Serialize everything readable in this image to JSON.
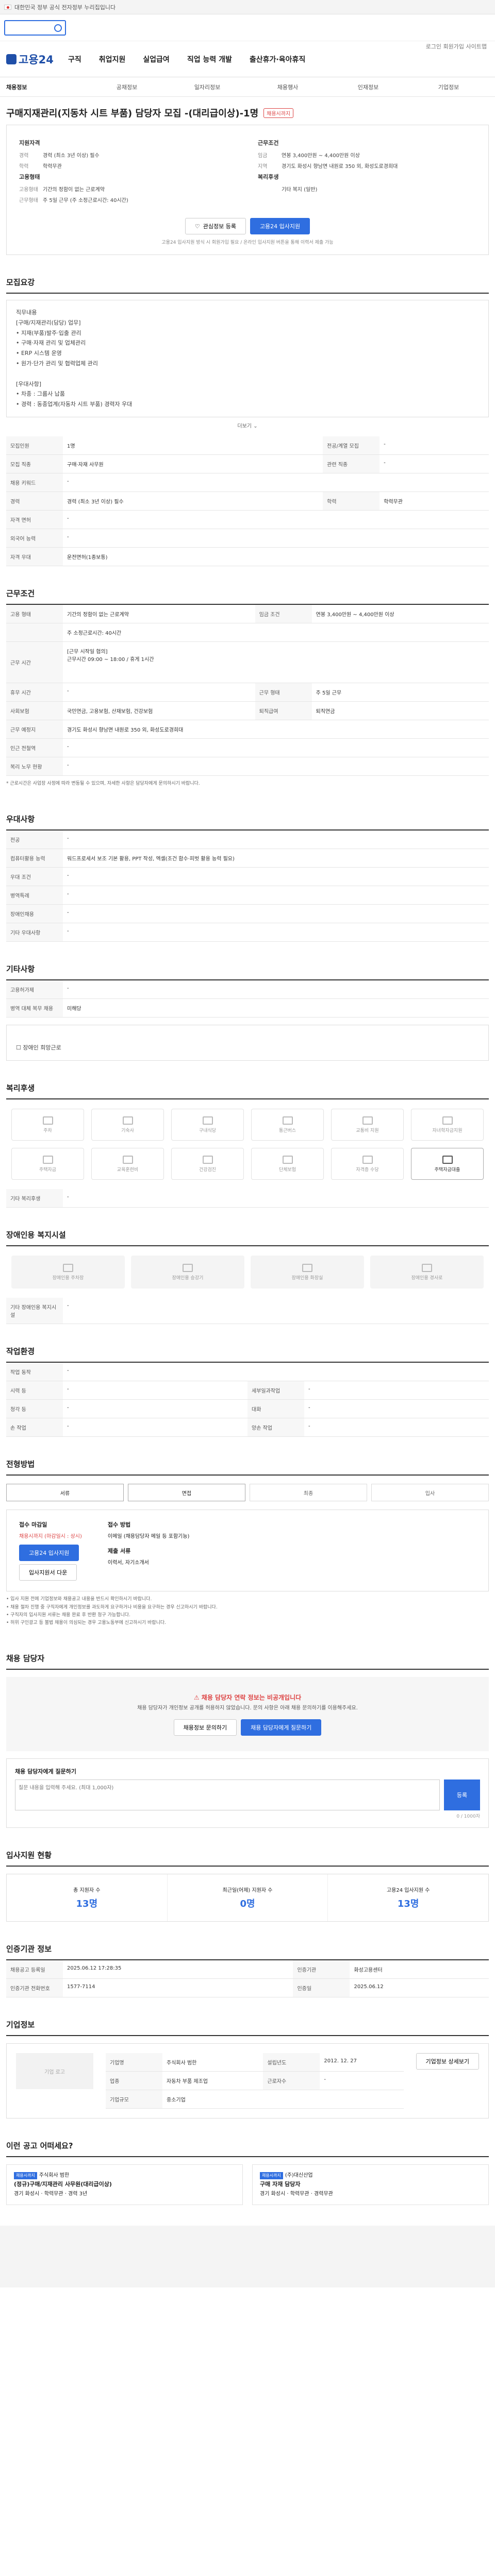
{
  "topbar": {
    "text": "대한민국 정부 공식 전자정부 누리집입니다"
  },
  "header": {
    "logo": "고용24",
    "util_links": "로그인  회원가입  사이트맵",
    "nav": [
      "구직",
      "취업지원",
      "실업급여",
      "직업 능력 개발",
      "출산휴가·육아휴직"
    ]
  },
  "lnb": {
    "items": [
      "채용정보",
      "공채정보",
      "일자리정보",
      "채용행사",
      "인재정보",
      "기업정보"
    ]
  },
  "job": {
    "title": "구매지재관리(지동차 시트 부품) 담당자 모집 -(대리급이상)-1명",
    "tag": "채용시까지",
    "company_name": "주식회사 범한",
    "summary_left_heading": "지원자격",
    "summary_right_heading": "근무조건",
    "left_rows": [
      {
        "k": "경력",
        "v": "경력 (최소 3년 이상) 필수"
      },
      {
        "k": "학력",
        "v": "학력무관"
      }
    ],
    "right_rows": [
      {
        "k": "임금",
        "v": "연봉 3,400만원 ~ 4,400만원 이상"
      },
      {
        "k": "지역",
        "v": "경기도 화성시 향남면 내원로 350 외, 화성도로경희대"
      }
    ],
    "left_rows2_heading": "고용형태",
    "left_rows2": [
      {
        "k": "고용형태",
        "v": "기간의 정함이 없는 근로계약"
      },
      {
        "k": "근무형태",
        "v": "주 5일 근무 (주 소정근로시간: 40시간)"
      }
    ],
    "right_rows2_heading": "복리후생",
    "right_rows2": [
      {
        "k": "",
        "v": "기타 복지 (일반)"
      }
    ],
    "save_label": "관심정보 등록",
    "apply_label": "고용24 입사지원",
    "notice": "고용24 입사지원 방식 시 회원가입 필요 / 온라인 입사지원 버튼을 통해 이력서 제출 가능"
  },
  "recruit": {
    "title": "모집요강",
    "body": "직무내용\n[구매/지재관리(담당) 업무]\n• 지재(부품)발주·입출 관리\n• 구매·자재 관리 및 업체관리\n• ERP 시스템 운영\n• 원가·단가 관리 및 협력업체 관리\n\n[우대사항]\n• 차종 : 그룹사 납품\n• 경력 : 동종업계(자동차 시트 부품) 경력자 우대",
    "more": "더보기",
    "table": [
      {
        "k": "모집인원",
        "v": "1명",
        "k2": "전공/계열 모집",
        "v2": "-"
      },
      {
        "k": "모집 직종",
        "v": "구매·자재 사무원",
        "k2": "관련 직종",
        "v2": "-"
      },
      {
        "k": "채용 키워드",
        "v": "-",
        "k2": "",
        "v2": ""
      },
      {
        "k": "경력",
        "v": "경력 (최소 3년 이상) 필수",
        "k2": "학력",
        "v2": "학력무관"
      },
      {
        "k": "자격 면허",
        "v": "-",
        "k2": "",
        "v2": ""
      },
      {
        "k": "외국어 능력",
        "v": "-",
        "k2": "",
        "v2": ""
      },
      {
        "k": "자격 우대",
        "v": "운전면허(1종보통)",
        "k2": "",
        "v2": ""
      }
    ]
  },
  "conditions": {
    "title": "근무조건",
    "table": [
      {
        "k": "고용 형태",
        "v": "기간의 정함이 없는 근로계약",
        "k2": "임금 조건",
        "v2": "연봉 3,400만원 ~ 4,400만원 이상"
      },
      {
        "k": "",
        "v": "주 소정근로시간: 40시간",
        "k2": "",
        "v2": ""
      },
      {
        "k": "근무 시간",
        "v": "[근무 시작일 협의]\n근무시간 09:00 ~ 18:00 / 휴게 1시간",
        "k2": "",
        "v2": ""
      },
      {
        "k": "휴무 시간",
        "v": "-",
        "k2": "근무 형태",
        "v2": "주 5일 근무"
      },
      {
        "k": "사회보험",
        "v": "국민연금, 고용보험, 산재보험, 건강보험",
        "k2": "퇴직급여",
        "v2": "퇴직연금"
      },
      {
        "k": "근무 예정지",
        "v": "경기도 화성시 향남면 내원로 350 외, 화성도로경희대",
        "k2": "",
        "v2": ""
      },
      {
        "k": "인근 전철역",
        "v": "-",
        "k2": "",
        "v2": ""
      },
      {
        "k": "복리 노무 현황",
        "v": "-",
        "k2": "",
        "v2": ""
      }
    ],
    "note": "* 근로시간은 사업장 사정에 따라 변동될 수 있으며, 자세한 사항은 담당자에게 문의하시기 바랍니다."
  },
  "preference": {
    "title": "우대사항",
    "table": [
      {
        "k": "전공",
        "v": "-"
      },
      {
        "k": "컴퓨터활용 능력",
        "v": "워드프로세서 보조 기본 활용, PPT 작성, 엑셀(조건 함수·피벗 활용 능력 필요)"
      },
      {
        "k": "우대 조건",
        "v": "-"
      },
      {
        "k": "병역특례",
        "v": "-"
      },
      {
        "k": "장애인채용",
        "v": "-"
      },
      {
        "k": "기타 우대사항",
        "v": "-"
      }
    ]
  },
  "etc": {
    "title": "기타사항",
    "table": [
      {
        "k": "고용허가제",
        "v": "-"
      },
      {
        "k": "병역 대체 복무 채용",
        "v": "미해당"
      }
    ],
    "checkbox_label": "장애인 희망근로"
  },
  "welfare": {
    "title": "복리후생",
    "cards": [
      {
        "icon": "parking-icon",
        "label": "주차",
        "active": false
      },
      {
        "icon": "bed-icon",
        "label": "기숙사",
        "active": false
      },
      {
        "icon": "meal-icon",
        "label": "구내식당",
        "active": false
      },
      {
        "icon": "bus-icon",
        "label": "통근버스",
        "active": false
      },
      {
        "icon": "car-icon",
        "label": "교통비 지원",
        "active": false
      },
      {
        "icon": "child-icon",
        "label": "자녀학자금지원",
        "active": false
      },
      {
        "icon": "housing-icon",
        "label": "주택자금",
        "active": false
      },
      {
        "icon": "training-icon",
        "label": "교육훈련비",
        "active": false
      },
      {
        "icon": "health-icon",
        "label": "건강검진",
        "active": false
      },
      {
        "icon": "insurance-icon",
        "label": "단체보험",
        "active": false
      },
      {
        "icon": "certificate-icon",
        "label": "자격증 수당",
        "active": false
      },
      {
        "icon": "housing-support-icon",
        "label": "주택자금대출",
        "active": true
      }
    ],
    "etc_label": "기타 복리후생",
    "etc_value": "-"
  },
  "disability": {
    "title": "장애인용 복지시설",
    "cards": [
      "장애인용 주차장",
      "장애인용 승강기",
      "장애인용 화장실",
      "장애인용 경사로"
    ],
    "etc_label": "기타 장애인용 복지시설",
    "etc_value": "-"
  },
  "environment": {
    "title": "작업환경",
    "table": [
      {
        "k": "작업 동작",
        "v": "-",
        "k2": "",
        "v2": ""
      },
      {
        "k": "시력 등",
        "v": "-",
        "k2": "세부일과작업",
        "v2": "-"
      },
      {
        "k": "청각 등",
        "v": "-",
        "k2": "대화",
        "v2": "-"
      },
      {
        "k": "손 작업",
        "v": "-",
        "k2": "양손 작업",
        "v2": "-"
      }
    ]
  },
  "process": {
    "title": "전형방법",
    "steps": [
      "서류",
      "면접",
      "최종",
      "입사"
    ],
    "apply_period_label": "접수 마감일",
    "apply_period": "채용시까지 (마감일시 : 상시)",
    "apply_button": "고용24 입사지원",
    "print_button": "입사지원서 다운",
    "method_label": "접수 방법",
    "method_value": "이메일 (채용담당자 메일 등 포함기능)",
    "doc_label": "제출 서류",
    "doc_value": "이력서, 자기소개서",
    "warnings": [
      "• 입사 지원 전에 기업정보와 채용공고 내용을 반드시 확인하시기 바랍니다.",
      "• 채용 절차 진행 중 구직자에게 개인정보를 과도하게 요구하거나 비용을 요구하는 경우 신고하시기 바랍니다.",
      "• 구직자의 입사지원 서류는 채용 완료 후 반환 청구 가능합니다.",
      "• 허위 구인광고 등 불법 채용이 의심되는 경우 고용노동부에 신고하시기 바랍니다."
    ]
  },
  "contact": {
    "title": "채용 담당자",
    "alert": "채용 담당자 연락 정보는 비공개입니다",
    "desc": "채용 담당자가 개인정보 공개를 허용하지 않았습니다. 문의 사항은 아래 채용 문의하기를 이용해주세요.",
    "btn1": "채용정보 문의하기",
    "btn2": "채용 담당자에게 질문하기"
  },
  "qa": {
    "title": "채용 담당자에게 질문하기",
    "placeholder": "질문 내용을 입력해 주세요. (최대 1,000자)",
    "submit": "등록",
    "count": "0 / 1000자"
  },
  "stats": {
    "title": "입사지원 현황",
    "items": [
      {
        "label": "총 지원자 수",
        "value": "13명"
      },
      {
        "label": "최근일(어제) 지원자 수",
        "value": "0명"
      },
      {
        "label": "고용24 입사지원 수",
        "value": "13명"
      }
    ]
  },
  "public_info": {
    "title": "인증기관 정보",
    "rows": [
      {
        "k": "채용공고 등록일",
        "v": "2025.06.12 17:28:35",
        "k2": "인증기관",
        "v2": "화성고용센터"
      },
      {
        "k": "인증기관 전화번호",
        "v": "1577-7114",
        "k2": "인증일",
        "v2": "2025.06.12"
      }
    ]
  },
  "company": {
    "title": "기업정보",
    "logo_label": "기업 로고",
    "rows": [
      {
        "k": "기업명",
        "v": "주식회사 범한",
        "k2": "설립년도",
        "v2": "2012. 12. 27"
      },
      {
        "k": "업종",
        "v": "자동차 부품 제조업",
        "k2": "근로자수",
        "v2": "-"
      },
      {
        "k": "기업규모",
        "v": "중소기업",
        "k2": "",
        "v2": ""
      }
    ],
    "link_label": "기업정보 상세보기"
  },
  "similar": {
    "title": "이런 공고 어떠세요?",
    "items": [
      {
        "badge": "채용시까지",
        "company": "주식회사 범한",
        "title": "(정규)구매/지재관리 사무원(대리급이상)",
        "info": "경기 화성시 · 학력무관 · 경력 3년"
      },
      {
        "badge": "채용시까지",
        "company": "(주)대신산업",
        "title": "구매 자재 담당자",
        "info": "경기 화성시 · 학력무관 · 경력무관"
      }
    ]
  }
}
